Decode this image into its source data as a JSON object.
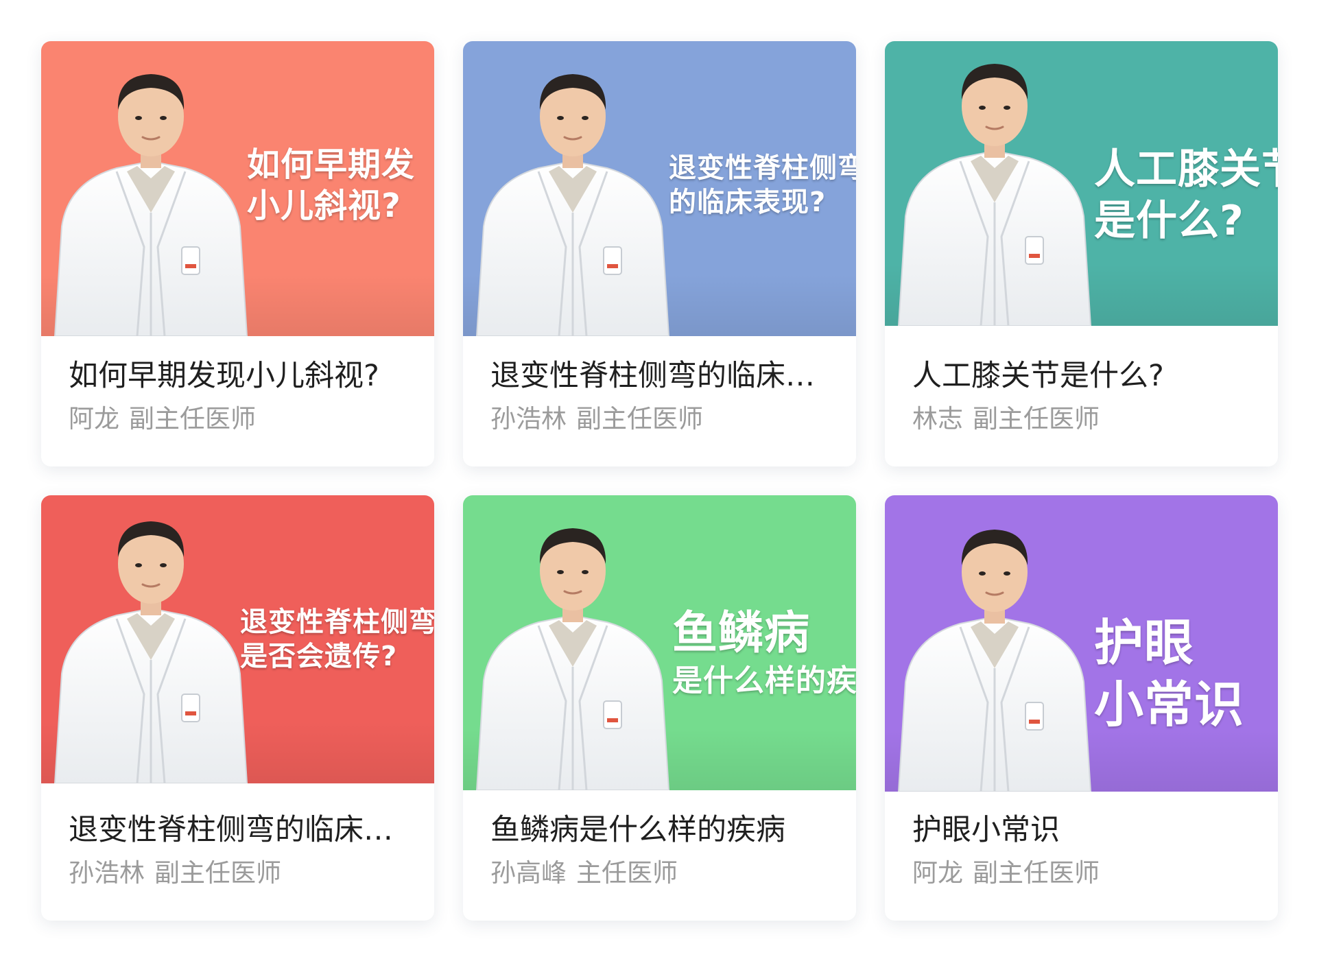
{
  "cards": [
    {
      "bg": "#FA8470",
      "overlay_line1": "如何早期发",
      "overlay_line2": "小儿斜视?",
      "title": "如何早期发现小儿斜视?",
      "doctor_name": "阿龙",
      "doctor_title": "副主任医师"
    },
    {
      "bg": "#85A3DA",
      "overlay_line1": "退变性脊柱侧弯",
      "overlay_line2": "的临床表现?",
      "title": "退变性脊柱侧弯的临床表现?",
      "doctor_name": "孙浩林",
      "doctor_title": "副主任医师"
    },
    {
      "bg": "#4EB3A7",
      "overlay_line1": "人工膝关节",
      "overlay_line2": "是什么?",
      "title": "人工膝关节是什么?",
      "doctor_name": "林志",
      "doctor_title": "副主任医师"
    },
    {
      "bg": "#EF5F5A",
      "overlay_line1": "退变性脊柱侧弯",
      "overlay_line2": "是否会遗传?",
      "title": "退变性脊柱侧弯的临床表现?",
      "doctor_name": "孙浩林",
      "doctor_title": "副主任医师"
    },
    {
      "bg": "#75DC8E",
      "overlay_line1": "鱼鳞病",
      "overlay_line2": "是什么样的疾病",
      "title": "鱼鳞病是什么样的疾病",
      "doctor_name": "孙高峰",
      "doctor_title": "主任医师"
    },
    {
      "bg": "#A274E7",
      "overlay_line1": "护眼",
      "overlay_line2": "小常识",
      "title": "护眼小常识",
      "doctor_name": "阿龙",
      "doctor_title": "副主任医师"
    }
  ]
}
